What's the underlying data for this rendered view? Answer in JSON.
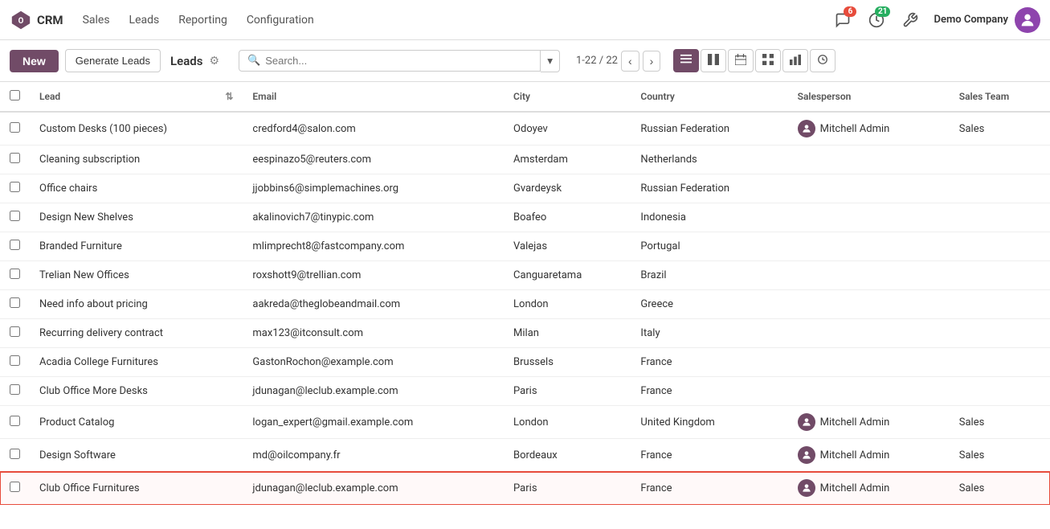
{
  "topnav": {
    "app_name": "CRM",
    "menu_items": [
      "Sales",
      "Leads",
      "Reporting",
      "Configuration"
    ],
    "notifications_badge": "6",
    "updates_badge": "21",
    "company": "Demo Company"
  },
  "toolbar": {
    "new_label": "New",
    "generate_label": "Generate Leads",
    "page_title": "Leads",
    "search_placeholder": "Search...",
    "pagination": "1-22 / 22"
  },
  "table": {
    "columns": [
      "Lead",
      "Email",
      "City",
      "Country",
      "Salesperson",
      "Sales Team"
    ],
    "rows": [
      {
        "lead": "Custom Desks (100 pieces)",
        "email": "credford4@salon.com",
        "city": "Odoyev",
        "country": "Russian Federation",
        "salesperson": "Mitchell Admin",
        "sales_team": "Sales",
        "has_avatar": true
      },
      {
        "lead": "Cleaning subscription",
        "email": "eespinazo5@reuters.com",
        "city": "Amsterdam",
        "country": "Netherlands",
        "salesperson": "",
        "sales_team": "",
        "has_avatar": false
      },
      {
        "lead": "Office chairs",
        "email": "jjobbins6@simplemachines.org",
        "city": "Gvardeysk",
        "country": "Russian Federation",
        "salesperson": "",
        "sales_team": "",
        "has_avatar": false
      },
      {
        "lead": "Design New Shelves",
        "email": "akalinovich7@tinypic.com",
        "city": "Boafeo",
        "country": "Indonesia",
        "salesperson": "",
        "sales_team": "",
        "has_avatar": false
      },
      {
        "lead": "Branded Furniture",
        "email": "mlimprecht8@fastcompany.com",
        "city": "Valejas",
        "country": "Portugal",
        "salesperson": "",
        "sales_team": "",
        "has_avatar": false
      },
      {
        "lead": "Trelian New Offices",
        "email": "roxshott9@trellian.com",
        "city": "Canguaretama",
        "country": "Brazil",
        "salesperson": "",
        "sales_team": "",
        "has_avatar": false
      },
      {
        "lead": "Need info about pricing",
        "email": "aakreda@theglobeandmail.com",
        "city": "London",
        "country": "Greece",
        "salesperson": "",
        "sales_team": "",
        "has_avatar": false
      },
      {
        "lead": "Recurring delivery contract",
        "email": "max123@itconsult.com",
        "city": "Milan",
        "country": "Italy",
        "salesperson": "",
        "sales_team": "",
        "has_avatar": false
      },
      {
        "lead": "Acadia College Furnitures",
        "email": "GastonRochon@example.com",
        "city": "Brussels",
        "country": "France",
        "salesperson": "",
        "sales_team": "",
        "has_avatar": false
      },
      {
        "lead": "Club Office More Desks",
        "email": "jdunagan@leclub.example.com",
        "city": "Paris",
        "country": "France",
        "salesperson": "",
        "sales_team": "",
        "has_avatar": false
      },
      {
        "lead": "Product Catalog",
        "email": "logan_expert@gmail.example.com",
        "city": "London",
        "country": "United Kingdom",
        "salesperson": "Mitchell Admin",
        "sales_team": "Sales",
        "has_avatar": true
      },
      {
        "lead": "Design Software",
        "email": "md@oilcompany.fr",
        "city": "Bordeaux",
        "country": "France",
        "salesperson": "Mitchell Admin",
        "sales_team": "Sales",
        "has_avatar": true
      },
      {
        "lead": "Club Office Furnitures",
        "email": "jdunagan@leclub.example.com",
        "city": "Paris",
        "country": "France",
        "salesperson": "Mitchell Admin",
        "sales_team": "Sales",
        "has_avatar": true,
        "highlighted": true
      }
    ]
  }
}
